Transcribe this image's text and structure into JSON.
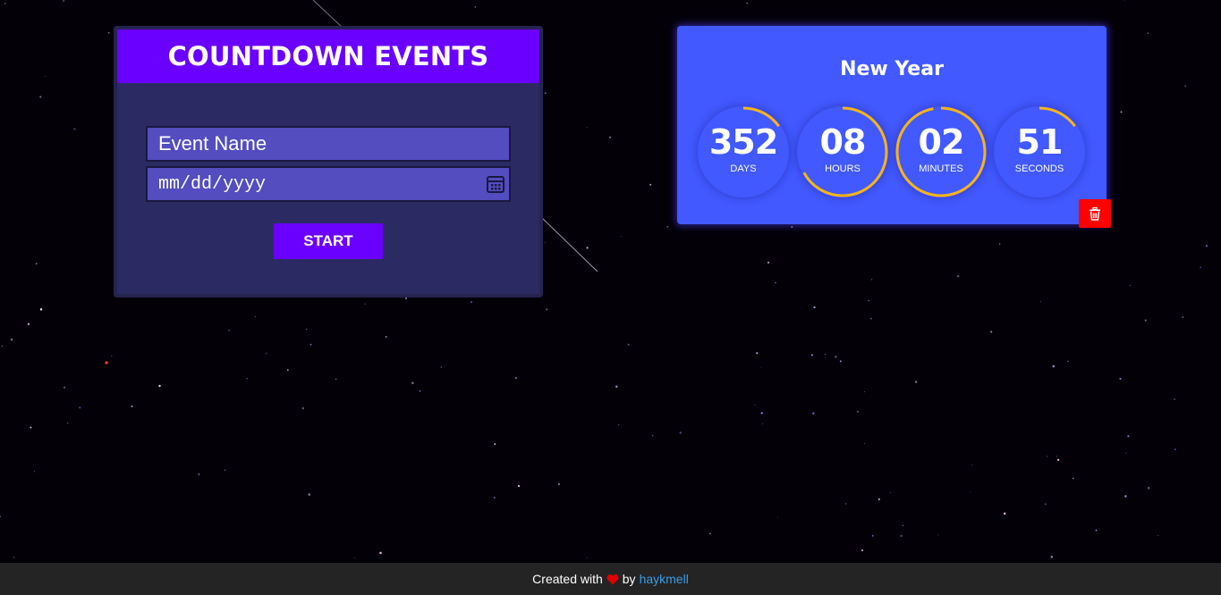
{
  "form": {
    "title": "COUNTDOWN EVENTS",
    "event_name_placeholder": "Event Name",
    "date_placeholder": "mm/dd/yyyy",
    "start_label": "START"
  },
  "event": {
    "title": "New Year",
    "days": {
      "value": "352",
      "label": "DAYS",
      "progress": 0.15
    },
    "hours": {
      "value": "08",
      "label": "HOURS",
      "progress": 0.67
    },
    "minutes": {
      "value": "02",
      "label": "MINUTES",
      "progress": 0.97
    },
    "seconds": {
      "value": "51",
      "label": "SECONDS",
      "progress": 0.15
    },
    "delete_icon": "trash-icon"
  },
  "footer": {
    "prefix": "Created with",
    "heart_icon": "heart-icon",
    "by": "by",
    "author": "haykmell"
  },
  "colors": {
    "background": "#030008",
    "form_panel": "#2c2a63",
    "form_header": "#6a00ff",
    "input_bg": "#534dc0",
    "card": "#4159ff",
    "ring_progress": "#f7b416",
    "delete_button": "#ff0000",
    "footer_bg": "#242424",
    "link": "#3b9ce6"
  }
}
